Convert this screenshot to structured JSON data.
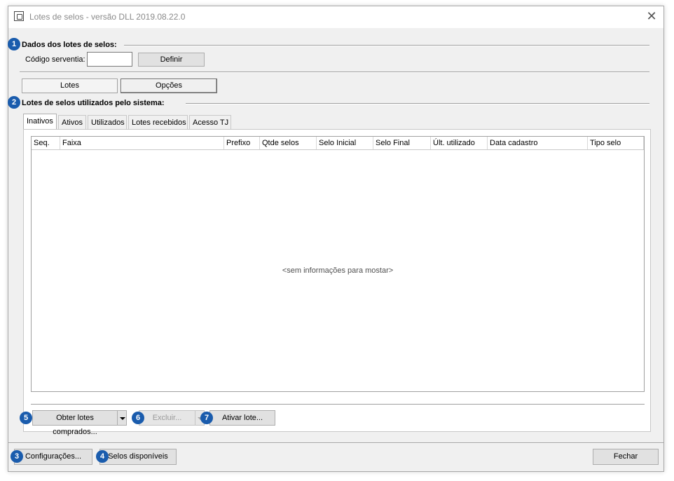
{
  "window": {
    "title": "Lotes de selos - versão DLL 2019.08.22.0",
    "close_glyph": "✕",
    "icon": "lock-app-icon"
  },
  "section1": {
    "badge": "1",
    "title": "Dados dos lotes de selos:",
    "codigo_label": "Código serventia:",
    "codigo_value": "",
    "definir_button": "Definir"
  },
  "toggle": {
    "lotes": "Lotes",
    "opcoes": "Opções",
    "selected": "Lotes"
  },
  "section2": {
    "badge": "2",
    "title": "Lotes de selos utilizados pelo sistema:"
  },
  "tabs": [
    {
      "label": "Inativos",
      "active": true
    },
    {
      "label": "Ativos"
    },
    {
      "label": "Utilizados"
    },
    {
      "label": "Lotes recebidos"
    },
    {
      "label": "Acesso TJ"
    }
  ],
  "grid": {
    "columns": [
      "Seq.",
      "Faixa",
      "Prefixo",
      "Qtde selos",
      "Selo Inicial",
      "Selo Final",
      "Últ. utilizado",
      "Data cadastro",
      "Tipo selo"
    ],
    "rows": [],
    "empty_message": "<sem informações para mostar>"
  },
  "panel_buttons": {
    "obter": {
      "badge": "5",
      "label": "Obter lotes comprados..."
    },
    "excluir": {
      "badge": "6",
      "label": "Excluir...",
      "enabled": false
    },
    "ativar": {
      "badge": "7",
      "label": "Ativar lote..."
    }
  },
  "footer": {
    "configuracoes": {
      "badge": "3",
      "label": "Configurações..."
    },
    "selos": {
      "badge": "4",
      "label": "Selos disponíveis"
    },
    "fechar": "Fechar"
  },
  "colors": {
    "badge": "#1a5cad",
    "window_bg": "#f0f0f0",
    "title_text": "#8a8a8a"
  }
}
